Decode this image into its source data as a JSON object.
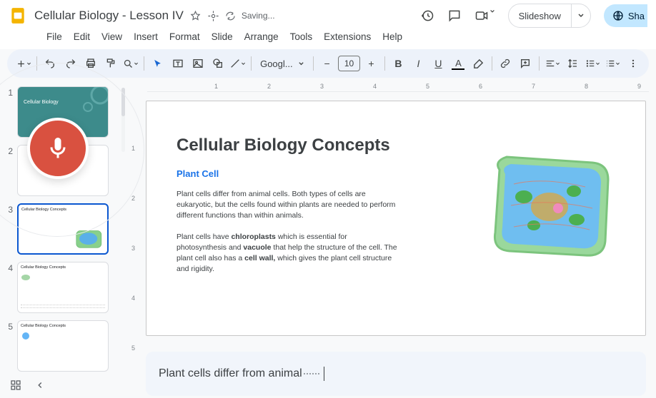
{
  "header": {
    "doc_title": "Cellular Biology - Lesson IV",
    "saving_label": "Saving...",
    "slideshow_label": "Slideshow",
    "share_label": "Sha"
  },
  "menus": [
    "File",
    "Edit",
    "View",
    "Insert",
    "Format",
    "Slide",
    "Arrange",
    "Tools",
    "Extensions",
    "Help"
  ],
  "toolbar": {
    "font_name": "Googl...",
    "font_size": "10"
  },
  "thumbnails": [
    {
      "num": "1",
      "title": "Cellular Biology"
    },
    {
      "num": "2",
      "title": ""
    },
    {
      "num": "3",
      "title": "Cellular Biology Concepts"
    },
    {
      "num": "4",
      "title": "Cellular Biology Concepts"
    },
    {
      "num": "5",
      "title": "Cellular Biology Concepts"
    }
  ],
  "ruler_h": [
    "1",
    "2",
    "3",
    "4",
    "5",
    "6",
    "7",
    "8",
    "9"
  ],
  "ruler_v": [
    "1",
    "2",
    "3",
    "4",
    "5"
  ],
  "slide": {
    "title": "Cellular Biology Concepts",
    "subtitle": "Plant Cell",
    "para1": "Plant cells differ from animal cells. Both types of cells are eukaryotic, but the cells found within plants are needed to perform different functions than within animals.",
    "para2_a": "Plant cells have ",
    "para2_b": "chloroplasts",
    "para2_c": " which is essential for photosynthesis and ",
    "para2_d": "vacuole",
    "para2_e": " that help the structure of the cell. The plant cell also has a ",
    "para2_f": "cell wall,",
    "para2_g": " which gives the plant cell structure and rigidity."
  },
  "dictation": {
    "text": "Plant cells differ from animal"
  }
}
